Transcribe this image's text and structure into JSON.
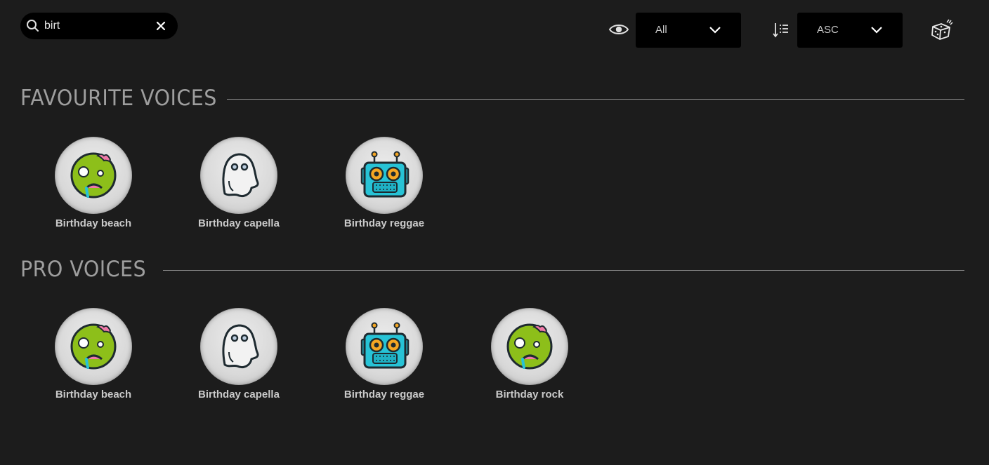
{
  "search": {
    "value": "birt",
    "placeholder": ""
  },
  "toolbar": {
    "filter_value": "All",
    "sort_value": "ASC"
  },
  "sections": [
    {
      "title": "FAVOURITE VOICES",
      "voices": [
        {
          "name": "Birthday beach",
          "icon": "zombie-face-icon"
        },
        {
          "name": "Birthday capella",
          "icon": "ghost-icon"
        },
        {
          "name": "Birthday reggae",
          "icon": "robot-icon"
        }
      ]
    },
    {
      "title": "PRO VOICES",
      "voices": [
        {
          "name": "Birthday beach",
          "icon": "zombie-face-icon"
        },
        {
          "name": "Birthday capella",
          "icon": "ghost-icon"
        },
        {
          "name": "Birthday reggae",
          "icon": "robot-icon"
        },
        {
          "name": "Birthday rock",
          "icon": "zombie-face-icon"
        }
      ]
    }
  ],
  "colors": {
    "background": "#1c1c1c",
    "control_background": "#000000",
    "zombie_green": "#8dbf1a",
    "robot_cyan": "#27c3d6"
  }
}
